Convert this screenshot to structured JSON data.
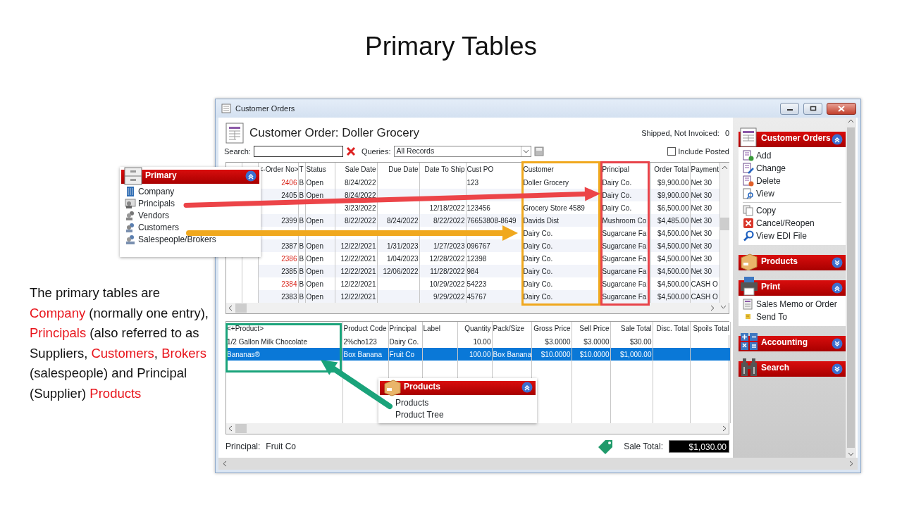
{
  "slide": {
    "title": "Primary Tables",
    "description": [
      {
        "text": "The primary tables are ",
        "emphasis": false
      },
      {
        "text": "Company",
        "emphasis": true
      },
      {
        "text": " (normally one entry), ",
        "emphasis": false
      },
      {
        "text": "Principals",
        "emphasis": true
      },
      {
        "text": " (also referred to as Suppliers, ",
        "emphasis": false
      },
      {
        "text": "Customers",
        "emphasis": true
      },
      {
        "text": ", ",
        "emphasis": false
      },
      {
        "text": "Brokers",
        "emphasis": true
      },
      {
        "text": " (salespeople) and Principal (Supplier) ",
        "emphasis": false
      },
      {
        "text": "Products",
        "emphasis": true
      }
    ]
  },
  "window": {
    "title": "Customer Orders"
  },
  "header": {
    "title": "Customer Order: Doller Grocery",
    "shipped_label": "Shipped, Not Invoiced:",
    "shipped_value": "0"
  },
  "search": {
    "label": "Search:",
    "queries_label": "Queries:",
    "query": "All Records",
    "include_posted": {
      "label": "Include Posted",
      "checked": false
    }
  },
  "orders": {
    "columns": [
      "<-Order No>",
      "T",
      "Status",
      "Sale Date",
      "Due Date",
      "Date To Ship",
      "Cust PO",
      "Customer",
      "Principal",
      "Order Total",
      "Payment"
    ],
    "rows": [
      {
        "highlighted": true,
        "order_no": "2406",
        "t": "B",
        "status": "Open",
        "sale_date": "8/24/2022",
        "cust_po": "123",
        "customer": "Doller Grocery",
        "principal": "Dairy Co.",
        "order_total": "$9,900.00",
        "payment": "Net 30"
      },
      {
        "highlighted": false,
        "order_no": "2405",
        "t": "B",
        "status": "Open",
        "sale_date": "8/24/2022",
        "principal": "Dairy Co.",
        "order_total": "$9,900.00",
        "payment": "Net 30"
      },
      {
        "sale_date": "3/23/2022",
        "date_to_ship": "12/18/2022",
        "cust_po": "123456",
        "customer": "Grocery Store 4589",
        "principal": "Dairy Co.",
        "order_total": "$6,500.00",
        "payment": "Net 30"
      },
      {
        "highlighted": false,
        "order_no": "2399",
        "t": "B",
        "status": "Open",
        "sale_date": "8/22/2022",
        "due_date": "8/24/2022",
        "date_to_ship": "8/22/2022",
        "cust_po": "76653808-8649",
        "customer": "Davids Dist",
        "principal": "Mushroom Co",
        "order_total": "$4,485.00",
        "payment": "Net 30"
      },
      {
        "customer": "Dairy Co.",
        "principal": "Sugarcane Fa",
        "order_total": "$4,500.00",
        "payment": "Net 30"
      },
      {
        "highlighted": false,
        "order_no": "2387",
        "t": "B",
        "status": "Open",
        "sale_date": "12/22/2021",
        "due_date": "1/31/2023",
        "date_to_ship": "1/27/2023",
        "cust_po": "096767",
        "customer": "Dairy Co.",
        "principal": "Sugarcane Fa",
        "order_total": "$4,500.00",
        "payment": "Net 30"
      },
      {
        "highlighted": true,
        "order_no": "2386",
        "t": "B",
        "status": "Open",
        "sale_date": "12/22/2021",
        "due_date": "1/04/2023",
        "date_to_ship": "12/28/2022",
        "cust_po": "12398",
        "customer": "Dairy Co.",
        "principal": "Sugarcane Fa",
        "order_total": "$4,500.00",
        "payment": "Net 30"
      },
      {
        "highlighted": false,
        "order_no": "2385",
        "t": "B",
        "status": "Open",
        "sale_date": "12/22/2021",
        "due_date": "12/06/2022",
        "date_to_ship": "11/28/2022",
        "cust_po": "984",
        "customer": "Dairy Co.",
        "principal": "Sugarcane Fa",
        "order_total": "$4,500.00",
        "payment": "Net 30"
      },
      {
        "highlighted": true,
        "order_no": "2384",
        "t": "B",
        "status": "Open",
        "sale_date": "12/22/2021",
        "date_to_ship": "10/29/2022",
        "cust_po": "54223",
        "customer": "Dairy Co.",
        "principal": "Sugarcane Fa",
        "order_total": "$4,500.00",
        "payment": "CASH O"
      },
      {
        "highlighted": false,
        "order_no": "2383",
        "t": "B",
        "status": "Open",
        "sale_date": "12/22/2021",
        "date_to_ship": "9/29/2022",
        "cust_po": "45767",
        "customer": "Dairy Co.",
        "principal": "Sugarcane Fa",
        "order_total": "$4,500.00",
        "payment": "CASH O"
      }
    ]
  },
  "order_lines": {
    "columns": [
      "<+Product>",
      "Product Code",
      "Principal",
      "Label",
      "Quantity",
      "Pack/Size",
      "Gross Price",
      "Sell Price",
      "Sale Total",
      "Disc. Total",
      "Spoils Total"
    ],
    "rows": [
      {
        "selected": false,
        "product": "1/2 Gallon Milk Chocolate",
        "product_code": "2%cho123",
        "principal": "Dairy Co.",
        "quantity": "10.00",
        "gross_price": "$3.0000",
        "sell_price": "$3.0000",
        "sale_total": "$30.00"
      },
      {
        "selected": true,
        "product": "Bananas®",
        "product_code": "Box Banana",
        "principal": "Fruit Co",
        "quantity": "100.00",
        "pack_size": "Box Banana",
        "gross_price": "$10.0000",
        "sell_price": "$10.0000",
        "sale_total": "$1,000.00"
      }
    ]
  },
  "footer": {
    "principal_label": "Principal:",
    "principal": "Fruit Co",
    "sale_total_label": "Sale Total:",
    "sale_total": "$1,030.00"
  },
  "side_panel": {
    "sections": [
      {
        "title": "Customer Orders",
        "expanded": true,
        "groups": [
          [
            "Add",
            "Change",
            "Delete",
            "View"
          ],
          [
            "Copy",
            "Cancel/Reopen",
            "View EDI File"
          ]
        ]
      },
      {
        "title": "Products",
        "expanded": false
      },
      {
        "title": "Print",
        "expanded": true,
        "groups": [
          [
            "Sales Memo or Order",
            "Send To"
          ]
        ]
      },
      {
        "title": "Accounting",
        "expanded": false
      },
      {
        "title": "Search",
        "expanded": false
      }
    ]
  },
  "callouts": {
    "primary_panel": {
      "title": "Primary",
      "expanded": true,
      "items": [
        "Company",
        "Principals",
        "Vendors",
        "Customers",
        "Salespeople/Brokers"
      ]
    },
    "products_panel": {
      "title": "Products",
      "expanded": true,
      "items": [
        "Products",
        "Product Tree"
      ]
    }
  }
}
